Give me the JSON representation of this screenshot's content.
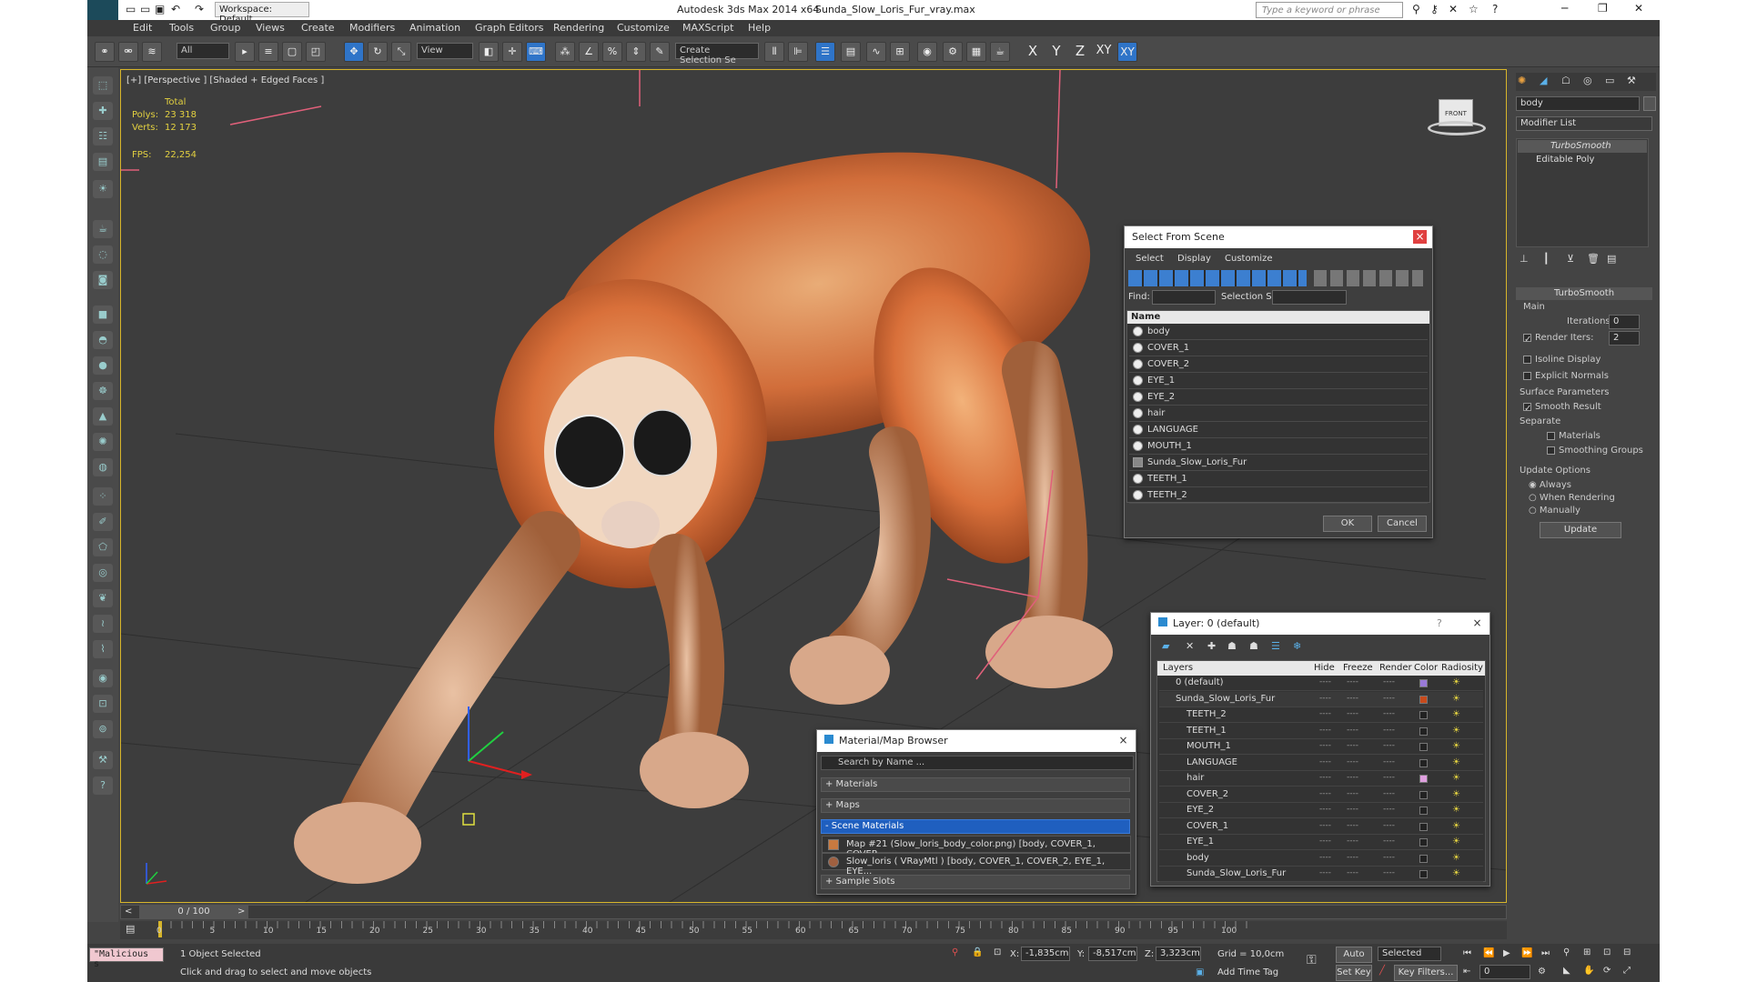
{
  "titlebar": {
    "workspace": "Workspace: Default",
    "app_title": "Autodesk 3ds Max  2014 x64",
    "file_name": "Sunda_Slow_Loris_Fur_vray.max",
    "search_placeholder": "Type a keyword or phrase"
  },
  "menu": [
    "Edit",
    "Tools",
    "Group",
    "Views",
    "Create",
    "Modifiers",
    "Animation",
    "Graph Editors",
    "Rendering",
    "Customize",
    "MAXScript",
    "Help"
  ],
  "toolbar": {
    "filter": "All",
    "ref_coord": "View",
    "named_selection": "Create Selection Se",
    "axes": [
      "X",
      "Y",
      "Z",
      "XY",
      "XY"
    ]
  },
  "viewport": {
    "label": "[+] [Perspective ] [Shaded + Edged Faces ]",
    "stats": {
      "total_label": "Total",
      "polys_label": "Polys:",
      "polys_value": "23 318",
      "verts_label": "Verts:",
      "verts_value": "12 173",
      "fps_label": "FPS:",
      "fps_value": "22,254"
    },
    "viewcube": "FRONT"
  },
  "select_from_scene": {
    "title": "Select From Scene",
    "menu": [
      "Select",
      "Display",
      "Customize"
    ],
    "find_label": "Find:",
    "selection_set_label": "Selection Set:",
    "column_name": "Name",
    "objects": [
      "body",
      "COVER_1",
      "COVER_2",
      "EYE_1",
      "EYE_2",
      "hair",
      "LANGUAGE",
      "MOUTH_1",
      "Sunda_Slow_Loris_Fur",
      "TEETH_1",
      "TEETH_2"
    ],
    "ok": "OK",
    "cancel": "Cancel"
  },
  "layer_dialog": {
    "title": "Layer: 0 (default)",
    "help": "?",
    "columns": [
      "Layers",
      "Hide",
      "Freeze",
      "Render",
      "Color",
      "Radiosity"
    ],
    "rows": [
      {
        "name": "0 (default)",
        "color": "#9a7ad8"
      },
      {
        "name": "Sunda_Slow_Loris_Fur",
        "color": "#c84a1c"
      },
      {
        "name": "TEETH_2",
        "color": "#222222"
      },
      {
        "name": "TEETH_1",
        "color": "#222222"
      },
      {
        "name": "MOUTH_1",
        "color": "#222222"
      },
      {
        "name": "LANGUAGE",
        "color": "#222222"
      },
      {
        "name": "hair",
        "color": "#e0a0e0"
      },
      {
        "name": "COVER_2",
        "color": "#222222"
      },
      {
        "name": "EYE_2",
        "color": "#222222"
      },
      {
        "name": "COVER_1",
        "color": "#222222"
      },
      {
        "name": "EYE_1",
        "color": "#222222"
      },
      {
        "name": "body",
        "color": "#222222"
      },
      {
        "name": "Sunda_Slow_Loris_Fur",
        "color": "#222222"
      }
    ],
    "dash": "----"
  },
  "material_browser": {
    "title": "Material/Map Browser",
    "search_placeholder": "Search by Name ...",
    "groups": [
      "+ Materials",
      "+ Maps",
      "- Scene Materials"
    ],
    "items": [
      "Map #21 (Slow_loris_body_color.png) [body, COVER_1, COVER...",
      "Slow_loris  ( VRayMtl ) [body, COVER_1, COVER_2, EYE_1, EYE..."
    ],
    "sample_slots": "+ Sample Slots"
  },
  "command_panel": {
    "object_name": "body",
    "modifier_list": "Modifier List",
    "stack": [
      "TurboSmooth",
      "Editable Poly"
    ],
    "rollout_title": "TurboSmooth",
    "main_label": "Main",
    "iterations_label": "Iterations:",
    "iterations_value": "0",
    "render_iters_label": "Render Iters:",
    "render_iters_value": "2",
    "isoline": "Isoline Display",
    "explicit_normals": "Explicit Normals",
    "surface_params": "Surface Parameters",
    "smooth_result": "Smooth Result",
    "separate": "Separate",
    "materials": "Materials",
    "smoothing_groups": "Smoothing Groups",
    "update_options": "Update Options",
    "always": "Always",
    "when_rendering": "When Rendering",
    "manually": "Manually",
    "update": "Update"
  },
  "timeline": {
    "frame": "0 / 100",
    "ticks": [
      "0",
      "5",
      "10",
      "15",
      "20",
      "25",
      "30",
      "35",
      "40",
      "45",
      "50",
      "55",
      "60",
      "65",
      "70",
      "75",
      "80",
      "85",
      "90",
      "95",
      "100"
    ]
  },
  "status": {
    "maxscript": "\"Malicious s",
    "selected": "1 Object Selected",
    "prompt": "Click and drag to select and move objects",
    "x_label": "X:",
    "x_value": "-1,835cm",
    "y_label": "Y:",
    "y_value": "-8,517cm",
    "z_label": "Z:",
    "z_value": "3,323cm",
    "grid": "Grid = 10,0cm",
    "add_time_tag": "Add Time Tag",
    "auto_key": "Auto Key",
    "set_key": "Set Key",
    "selected_combo": "Selected",
    "key_filters": "Key Filters...",
    "frame_field": "0"
  },
  "colors": {
    "viewport_border": "#d7b52a",
    "accent": "#2f74c8",
    "fur": "#d9703a"
  }
}
